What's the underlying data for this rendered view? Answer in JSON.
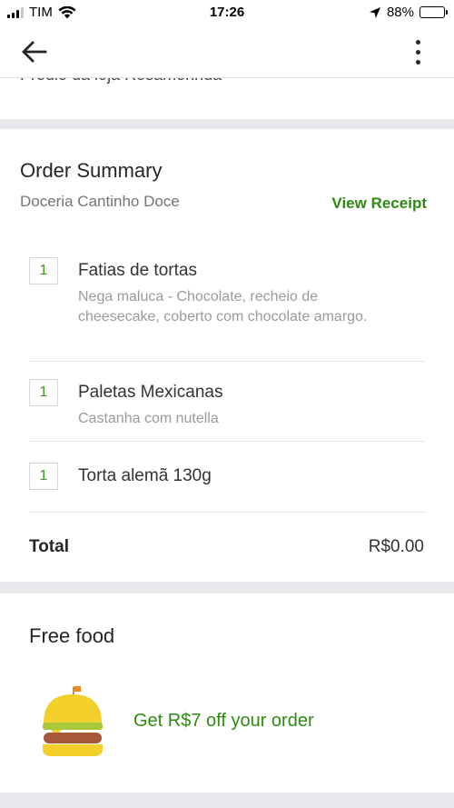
{
  "status_bar": {
    "carrier": "TIM",
    "time": "17:26",
    "battery": "88%"
  },
  "order_address_partial": "Predio da loja Rosamerinda",
  "order_summary": {
    "title": "Order Summary",
    "store": "Doceria Cantinho Doce",
    "view_receipt": "View Receipt",
    "items": [
      {
        "qty": "1",
        "name": "Fatias de tortas",
        "desc": "Nega maluca - Chocolate, recheio de cheesecake, coberto com chocolate amargo."
      },
      {
        "qty": "1",
        "name": "Paletas Mexicanas",
        "desc": "Castanha com nutella"
      },
      {
        "qty": "1",
        "name": "Torta alemã 130g",
        "desc": ""
      }
    ],
    "total_label": "Total",
    "total_value": "R$0.00"
  },
  "free_food": {
    "title": "Free food",
    "promo": "Get R$7 off your order"
  },
  "colors": {
    "accent_green": "#2e8b12",
    "section_gap": "#e7e7ec"
  }
}
